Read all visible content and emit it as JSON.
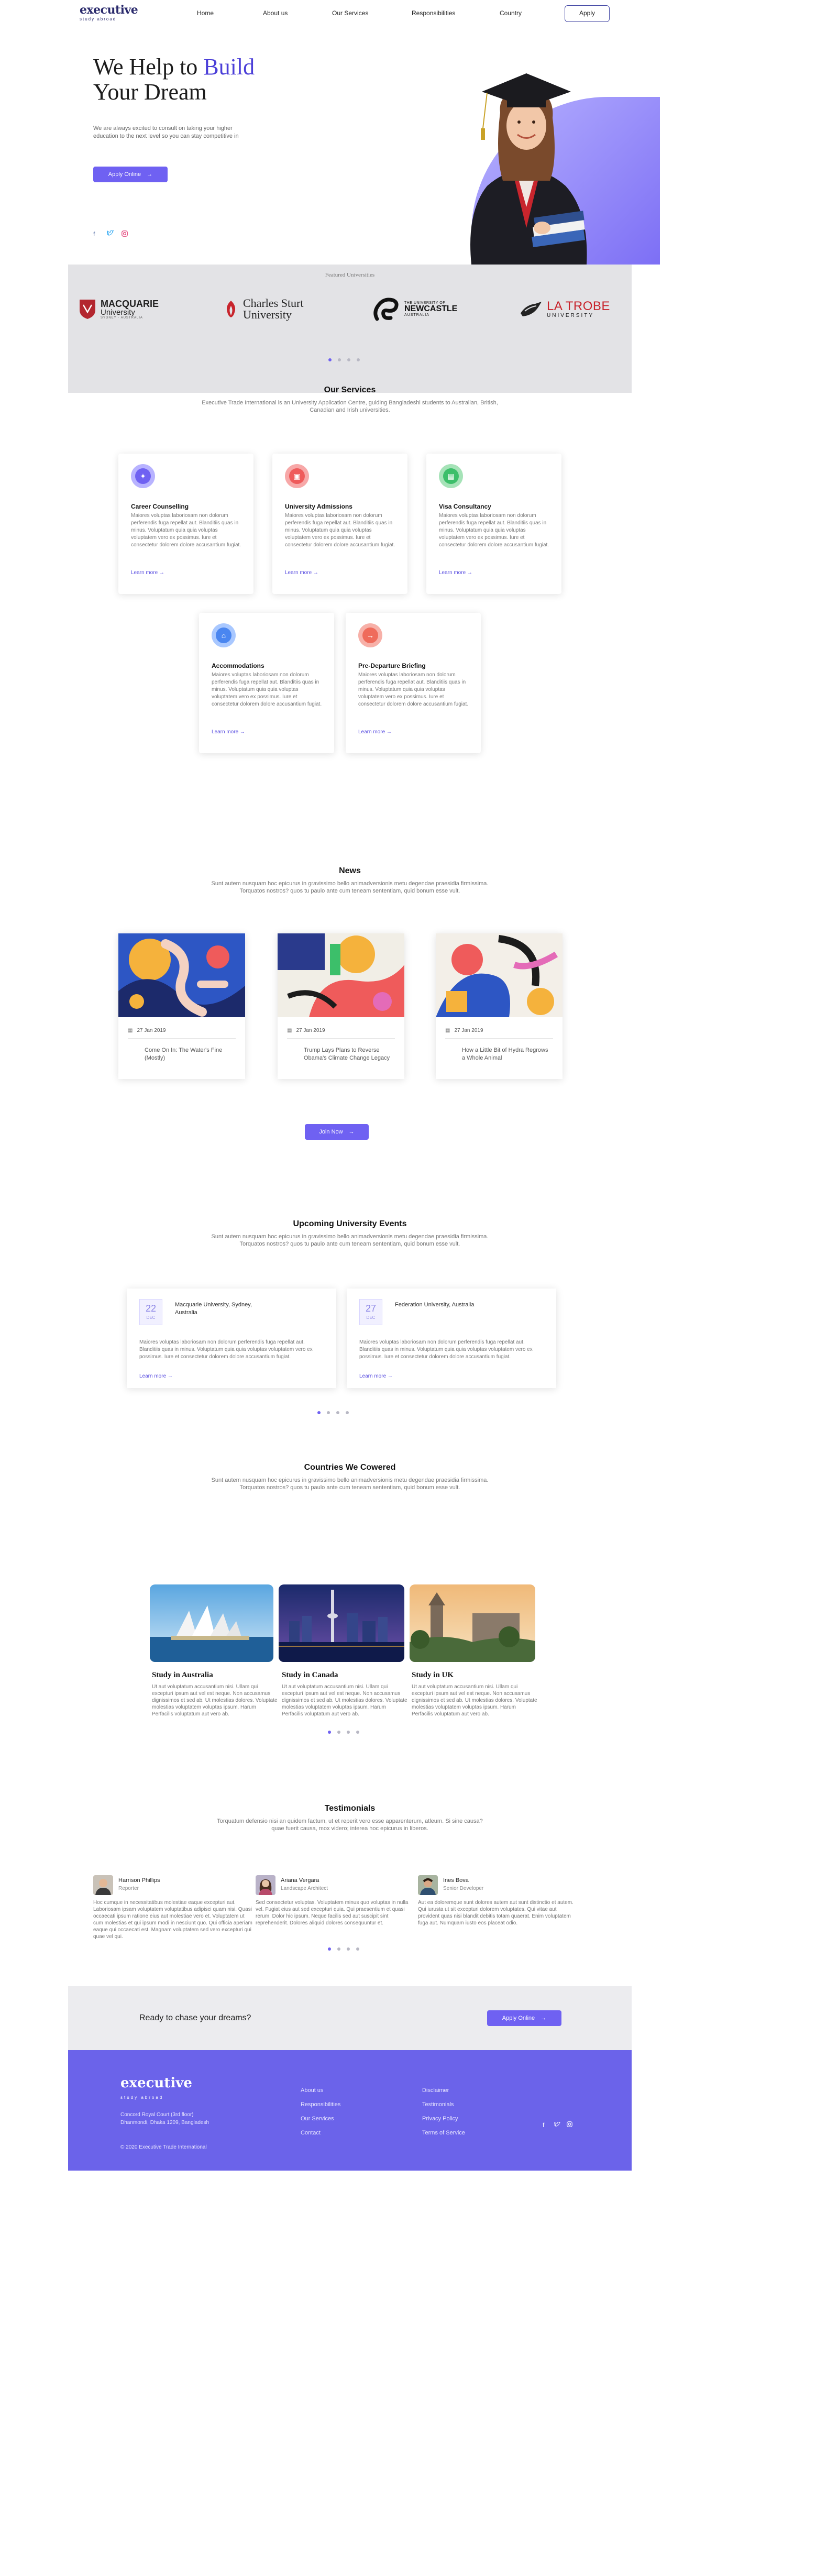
{
  "header": {
    "logo_main": "executive",
    "logo_sub": "study abroad",
    "nav": [
      "Home",
      "About us",
      "Our Services",
      "Responsibilities",
      "Country"
    ],
    "apply_label": "Apply"
  },
  "hero": {
    "title_line1_a": "We Help to ",
    "title_line1_b": "Build",
    "title_line2": "Your Dream",
    "text": "We are always excited to consult on taking your higher education to the next level so you can stay competitive in",
    "button_label": "Apply Online",
    "socials": [
      "facebook-icon",
      "twitter-icon",
      "instagram-icon"
    ]
  },
  "featured": {
    "title": "Featured Universities",
    "universities": [
      {
        "name": "MACQUARIE",
        "sub1": "University",
        "sub2": "SYDNEY · AUSTRALIA"
      },
      {
        "name": "Charles Sturt",
        "sub1": "University",
        "sub2": ""
      },
      {
        "name": "THE UNIVERSITY OF",
        "sub1": "NEWCASTLE",
        "sub2": "AUSTRALIA"
      },
      {
        "name": "LA TROBE",
        "sub1": "UNIVERSITY",
        "sub2": ""
      }
    ]
  },
  "services": {
    "title": "Our Services",
    "subtitle": "Executive Trade International is an University Application Centre, guiding Bangladeshi students to Australian, British, Canadian and Irish universities.",
    "items": [
      {
        "title": "Career Counselling",
        "text": "Maiores voluptas laboriosam non dolorum perferendis fuga repellat aut. Blanditiis quas in minus. Voluptatum quia quia voluptas voluptatem vero ex possimus. Iure et consectetur dolorem dolore accusantium fugiat.",
        "link": "Learn more"
      },
      {
        "title": "University Admissions",
        "text": "Maiores voluptas laboriosam non dolorum perferendis fuga repellat aut. Blanditiis quas in minus. Voluptatum quia quia voluptas voluptatem vero ex possimus. Iure et consectetur dolorem dolore accusantium fugiat.",
        "link": "Learn more"
      },
      {
        "title": "Visa Consultancy",
        "text": "Maiores voluptas laboriosam non dolorum perferendis fuga repellat aut. Blanditiis quas in minus. Voluptatum quia quia voluptas voluptatem vero ex possimus. Iure et consectetur dolorem dolore accusantium fugiat.",
        "link": "Learn more"
      },
      {
        "title": "Accommodations",
        "text": "Maiores voluptas laboriosam non dolorum perferendis fuga repellat aut. Blanditiis quas in minus. Voluptatum quia quia voluptas voluptatem vero ex possimus. Iure et consectetur dolorem dolore accusantium fugiat.",
        "link": "Learn more"
      },
      {
        "title": "Pre-Departure Briefing",
        "text": "Maiores voluptas laboriosam non dolorum perferendis fuga repellat aut. Blanditiis quas in minus. Voluptatum quia quia voluptas voluptatem vero ex possimus. Iure et consectetur dolorem dolore accusantium fugiat.",
        "link": "Learn more"
      }
    ]
  },
  "news": {
    "title": "News",
    "subtitle": "Sunt autem nusquam hoc epicurus in gravissimo bello animadversionis metu degendae praesidia firmissima. Torquatos nostros? quos tu paulo ante cum teneam sententiam, quid bonum esse vult.",
    "items": [
      {
        "date": "27 Jan 2019",
        "title": "Come On In: The Water's Fine (Mostly)"
      },
      {
        "date": "27 Jan 2019",
        "title": "Trump Lays Plans to Reverse Obama's Climate Change Legacy"
      },
      {
        "date": "27 Jan 2019",
        "title": "How a Little Bit of Hydra Regrows a Whole Animal"
      }
    ],
    "button_label": "Join Now"
  },
  "events": {
    "title": "Upcoming University Events",
    "subtitle": "Sunt autem nusquam hoc epicurus in gravissimo bello animadversionis metu degendae praesidia firmissima. Torquatos nostros? quos tu paulo ante cum teneam sententiam, quid bonum esse vult.",
    "items": [
      {
        "day": "22",
        "month": "DEC",
        "location": "Macquarie University, Sydney, Australia",
        "text": "Maiores voluptas laboriosam non dolorum perferendis fuga repellat aut. Blanditiis quas in minus. Voluptatum quia quia voluptas voluptatem vero ex possimus. Iure et consectetur dolorem dolore accusantium fugiat.",
        "link": "Learn more"
      },
      {
        "day": "27",
        "month": "DEC",
        "location": "Federation University, Australia",
        "text": "Maiores voluptas laboriosam non dolorum perferendis fuga repellat aut. Blanditiis quas in minus. Voluptatum quia quia voluptas voluptatem vero ex possimus. Iure et consectetur dolorem dolore accusantium fugiat.",
        "link": "Learn more"
      }
    ]
  },
  "countries": {
    "title": "Countries We Cowered",
    "subtitle": "Sunt autem nusquam hoc epicurus in gravissimo bello animadversionis metu degendae praesidia firmissima. Torquatos nostros? quos tu paulo ante cum teneam sententiam, quid bonum esse vult.",
    "items": [
      {
        "title": "Study in Australia",
        "text": "Ut aut voluptatum accusantium nisi. Ullam qui excepturi ipsum aut vel est neque. Non accusamus dignissimos et sed ab. Ut molestias dolores. Voluptate molestias voluptatem voluptas ipsum. Harum Perfacilis voluptatum aut vero ab."
      },
      {
        "title": "Study in Canada",
        "text": "Ut aut voluptatum accusantium nisi. Ullam qui excepturi ipsum aut vel est neque. Non accusamus dignissimos et sed ab. Ut molestias dolores. Voluptate molestias voluptatem voluptas ipsum. Harum Perfacilis voluptatum aut vero ab."
      },
      {
        "title": "Study in UK",
        "text": "Ut aut voluptatum accusantium nisi. Ullam qui excepturi ipsum aut vel est neque. Non accusamus dignissimos et sed ab. Ut molestias dolores. Voluptate molestias voluptatem voluptas ipsum. Harum Perfacilis voluptatum aut vero ab."
      }
    ]
  },
  "testimonials": {
    "title": "Testimonials",
    "subtitle": "Torquatum defensio nisi an quidem factum, ut et reperit vero esse apparenterum, atleum. Si sine causa? quae fuerit causa, mox videro; interea hoc epicurus in liberos.",
    "items": [
      {
        "name": "Harrison Phillips",
        "role": "Reporter",
        "quote": "Hoc cumque in necessitatibus molestiae eaque excepturi aut. Laboriosam ipsam voluptatem voluptatibus adipisci quam nisi. Quasi occaecati ipsum ratione eius aut molestiae vero et. Voluptatem ut cum molestias et qui ipsum modi in nesciunt quo. Qui officia aperiam eaque qui occaecati est. Magnam voluptatem sed vero excepturi qui quae vel qui."
      },
      {
        "name": "Ariana Vergara",
        "role": "Landscape Architect",
        "quote": "Sed consectetur voluptas. Voluptatem minus quo voluptas in nulla vel. Fugiat eius aut sed excepturi quia. Qui praesentium et quasi rerum. Dolor hic ipsum. Neque facilis sed aut suscipit sint reprehenderit. Dolores aliquid dolores consequuntur et."
      },
      {
        "name": "Ines Bova",
        "role": "Senior Developer",
        "quote": "Aut ea doloremque sunt dolores autem aut sunt distinctio et autem. Qui iurusta ut sit excepturi dolorem voluptates. Qui vitae aut provident quas nisi blandit debitis totam quaerat. Enim voluptatem fuga aut. Numquam iusto eos placeat odio."
      }
    ]
  },
  "cta": {
    "text": "Ready to chase your dreams?",
    "button_label": "Apply Online"
  },
  "footer": {
    "logo_main": "executive",
    "logo_sub": "study abroad",
    "address_line1": "Concord Royal Court (3rd floor)",
    "address_line2": "Dhanmondi, Dhaka 1209, Bangladesh",
    "copyright": "© 2020 Executive Trade International",
    "col1": [
      "About us",
      "Responsibilities",
      "Our Services",
      "Contact"
    ],
    "col2": [
      "Disclaimer",
      "Testimonials",
      "Privacy Policy",
      "Terms of Service"
    ],
    "socials": [
      "facebook-icon",
      "twitter-icon",
      "instagram-icon"
    ]
  },
  "colors": {
    "accent": "#6f61f2",
    "brand_dark": "#2a2a6c",
    "footer_bg": "#6b63ea",
    "featured_bg": "#e3e3e6"
  }
}
